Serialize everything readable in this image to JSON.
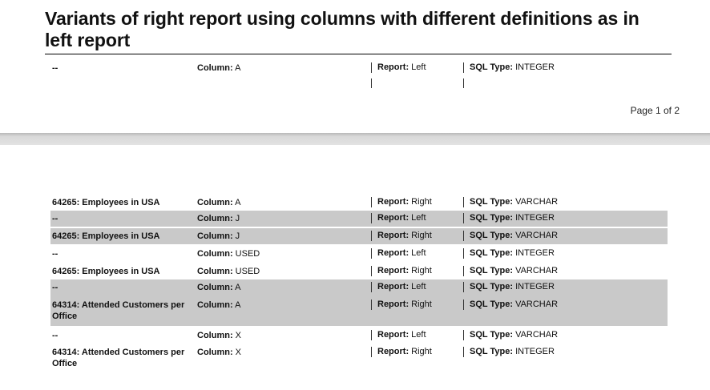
{
  "report": {
    "title": "Variants of right report using columns with different definitions as in left report",
    "page_number": "Page 1 of 2"
  },
  "labels": {
    "column": "Column:",
    "report": "Report:",
    "sql_type": "SQL Type:"
  },
  "page1_rows": [
    {
      "name": "--",
      "column": "A",
      "report": "Left",
      "sql_type": "INTEGER"
    }
  ],
  "page2_rows": [
    {
      "name": "64265: Employees in USA",
      "column": "A",
      "report": "Right",
      "sql_type": "VARCHAR",
      "shaded": false
    },
    {
      "name": "--",
      "column": "J",
      "report": "Left",
      "sql_type": "INTEGER",
      "shaded": true
    },
    {
      "name": "64265: Employees in USA",
      "column": "J",
      "report": "Right",
      "sql_type": "VARCHAR",
      "shaded": true
    },
    {
      "name": "--",
      "column": "USED",
      "report": "Left",
      "sql_type": "INTEGER",
      "shaded": false
    },
    {
      "name": "64265: Employees in USA",
      "column": "USED",
      "report": "Right",
      "sql_type": "VARCHAR",
      "shaded": false
    },
    {
      "name": "--",
      "column": "A",
      "report": "Left",
      "sql_type": "INTEGER",
      "shaded": true
    },
    {
      "name": "64314: Attended Customers per Office",
      "column": "A",
      "report": "Right",
      "sql_type": "VARCHAR",
      "shaded": true
    },
    {
      "name": "--",
      "column": "X",
      "report": "Left",
      "sql_type": "VARCHAR",
      "shaded": false
    },
    {
      "name": "64314: Attended Customers per Office",
      "column": "X",
      "report": "Right",
      "sql_type": "INTEGER",
      "shaded": false
    }
  ]
}
